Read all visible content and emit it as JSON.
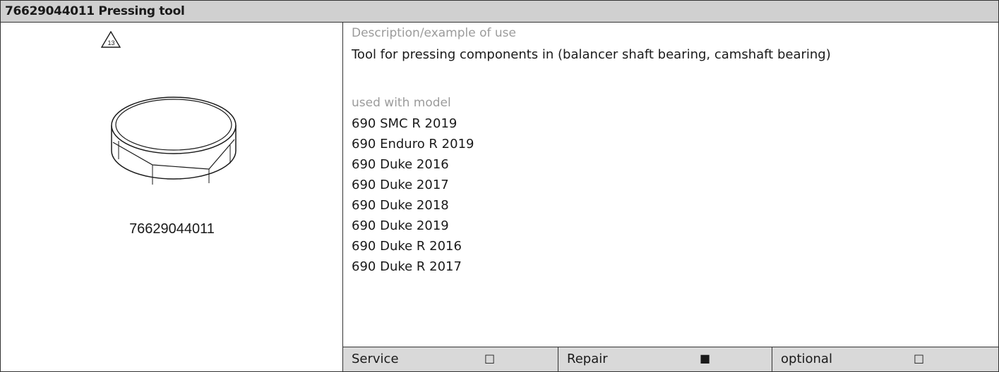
{
  "header": {
    "title": "76629044011 Pressing tool"
  },
  "figure": {
    "warning_icon": "triangle-13-icon",
    "warning_number": "13",
    "drawing": "pressing-tool-disc-drawing",
    "part_number": "76629044011"
  },
  "info": {
    "description_label": "Description/example of use",
    "description": "Tool for pressing components in (balancer shaft bearing, camshaft bearing)",
    "models_label": "used with model",
    "models": [
      "690 SMC R 2019",
      "690 Enduro R 2019",
      "690 Duke 2016",
      "690 Duke 2017",
      "690 Duke 2018",
      "690 Duke 2019",
      "690 Duke R 2016",
      "690 Duke R 2017"
    ]
  },
  "footer": {
    "service": {
      "label": "Service",
      "box": "□"
    },
    "repair": {
      "label": "Repair",
      "box": "■"
    },
    "optional": {
      "label": "optional",
      "box": "□"
    }
  }
}
